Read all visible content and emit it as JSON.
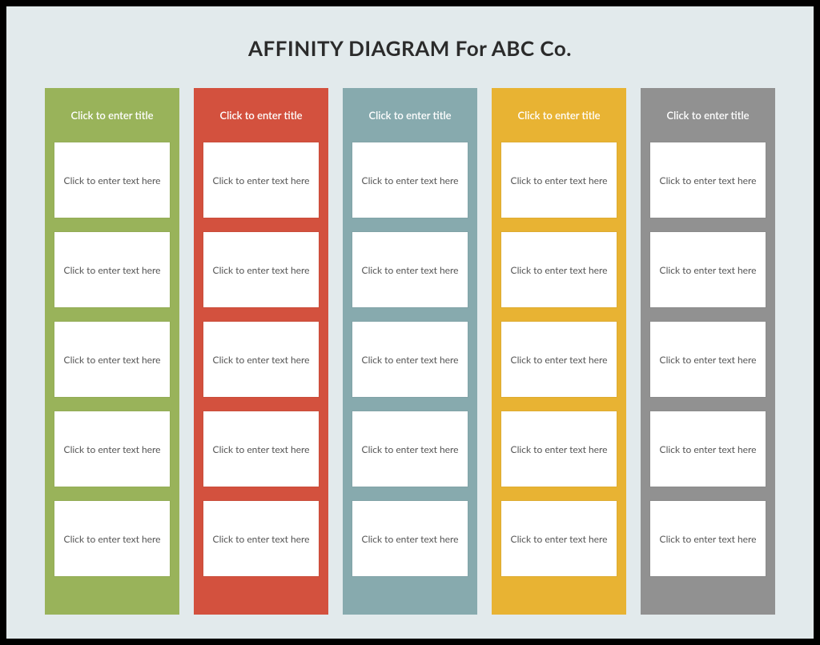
{
  "title": "AFFINITY DIAGRAM For ABC Co.",
  "placeholders": {
    "title": "Click to enter title",
    "card": "Click to enter text here"
  },
  "columns": [
    {
      "color": "#99b35a",
      "title": "Click to enter title",
      "cards": [
        "Click to enter text here",
        "Click to enter text here",
        "Click to enter text here",
        "Click to enter text here",
        "Click to enter text here"
      ]
    },
    {
      "color": "#d3513e",
      "title": "Click to enter title",
      "cards": [
        "Click to enter text here",
        "Click to enter text here",
        "Click to enter text here",
        "Click to enter text here",
        "Click to enter text here"
      ]
    },
    {
      "color": "#87aaae",
      "title": "Click to enter title",
      "cards": [
        "Click to enter text here",
        "Click to enter text here",
        "Click to enter text here",
        "Click to enter text here",
        "Click to enter text here"
      ]
    },
    {
      "color": "#e8b333",
      "title": "Click to enter title",
      "cards": [
        "Click to enter text here",
        "Click to enter text here",
        "Click to enter text here",
        "Click to enter text here",
        "Click to enter text here"
      ]
    },
    {
      "color": "#919191",
      "title": "Click to enter title",
      "cards": [
        "Click to enter text here",
        "Click to enter text here",
        "Click to enter text here",
        "Click to enter text here",
        "Click to enter text here"
      ]
    }
  ]
}
